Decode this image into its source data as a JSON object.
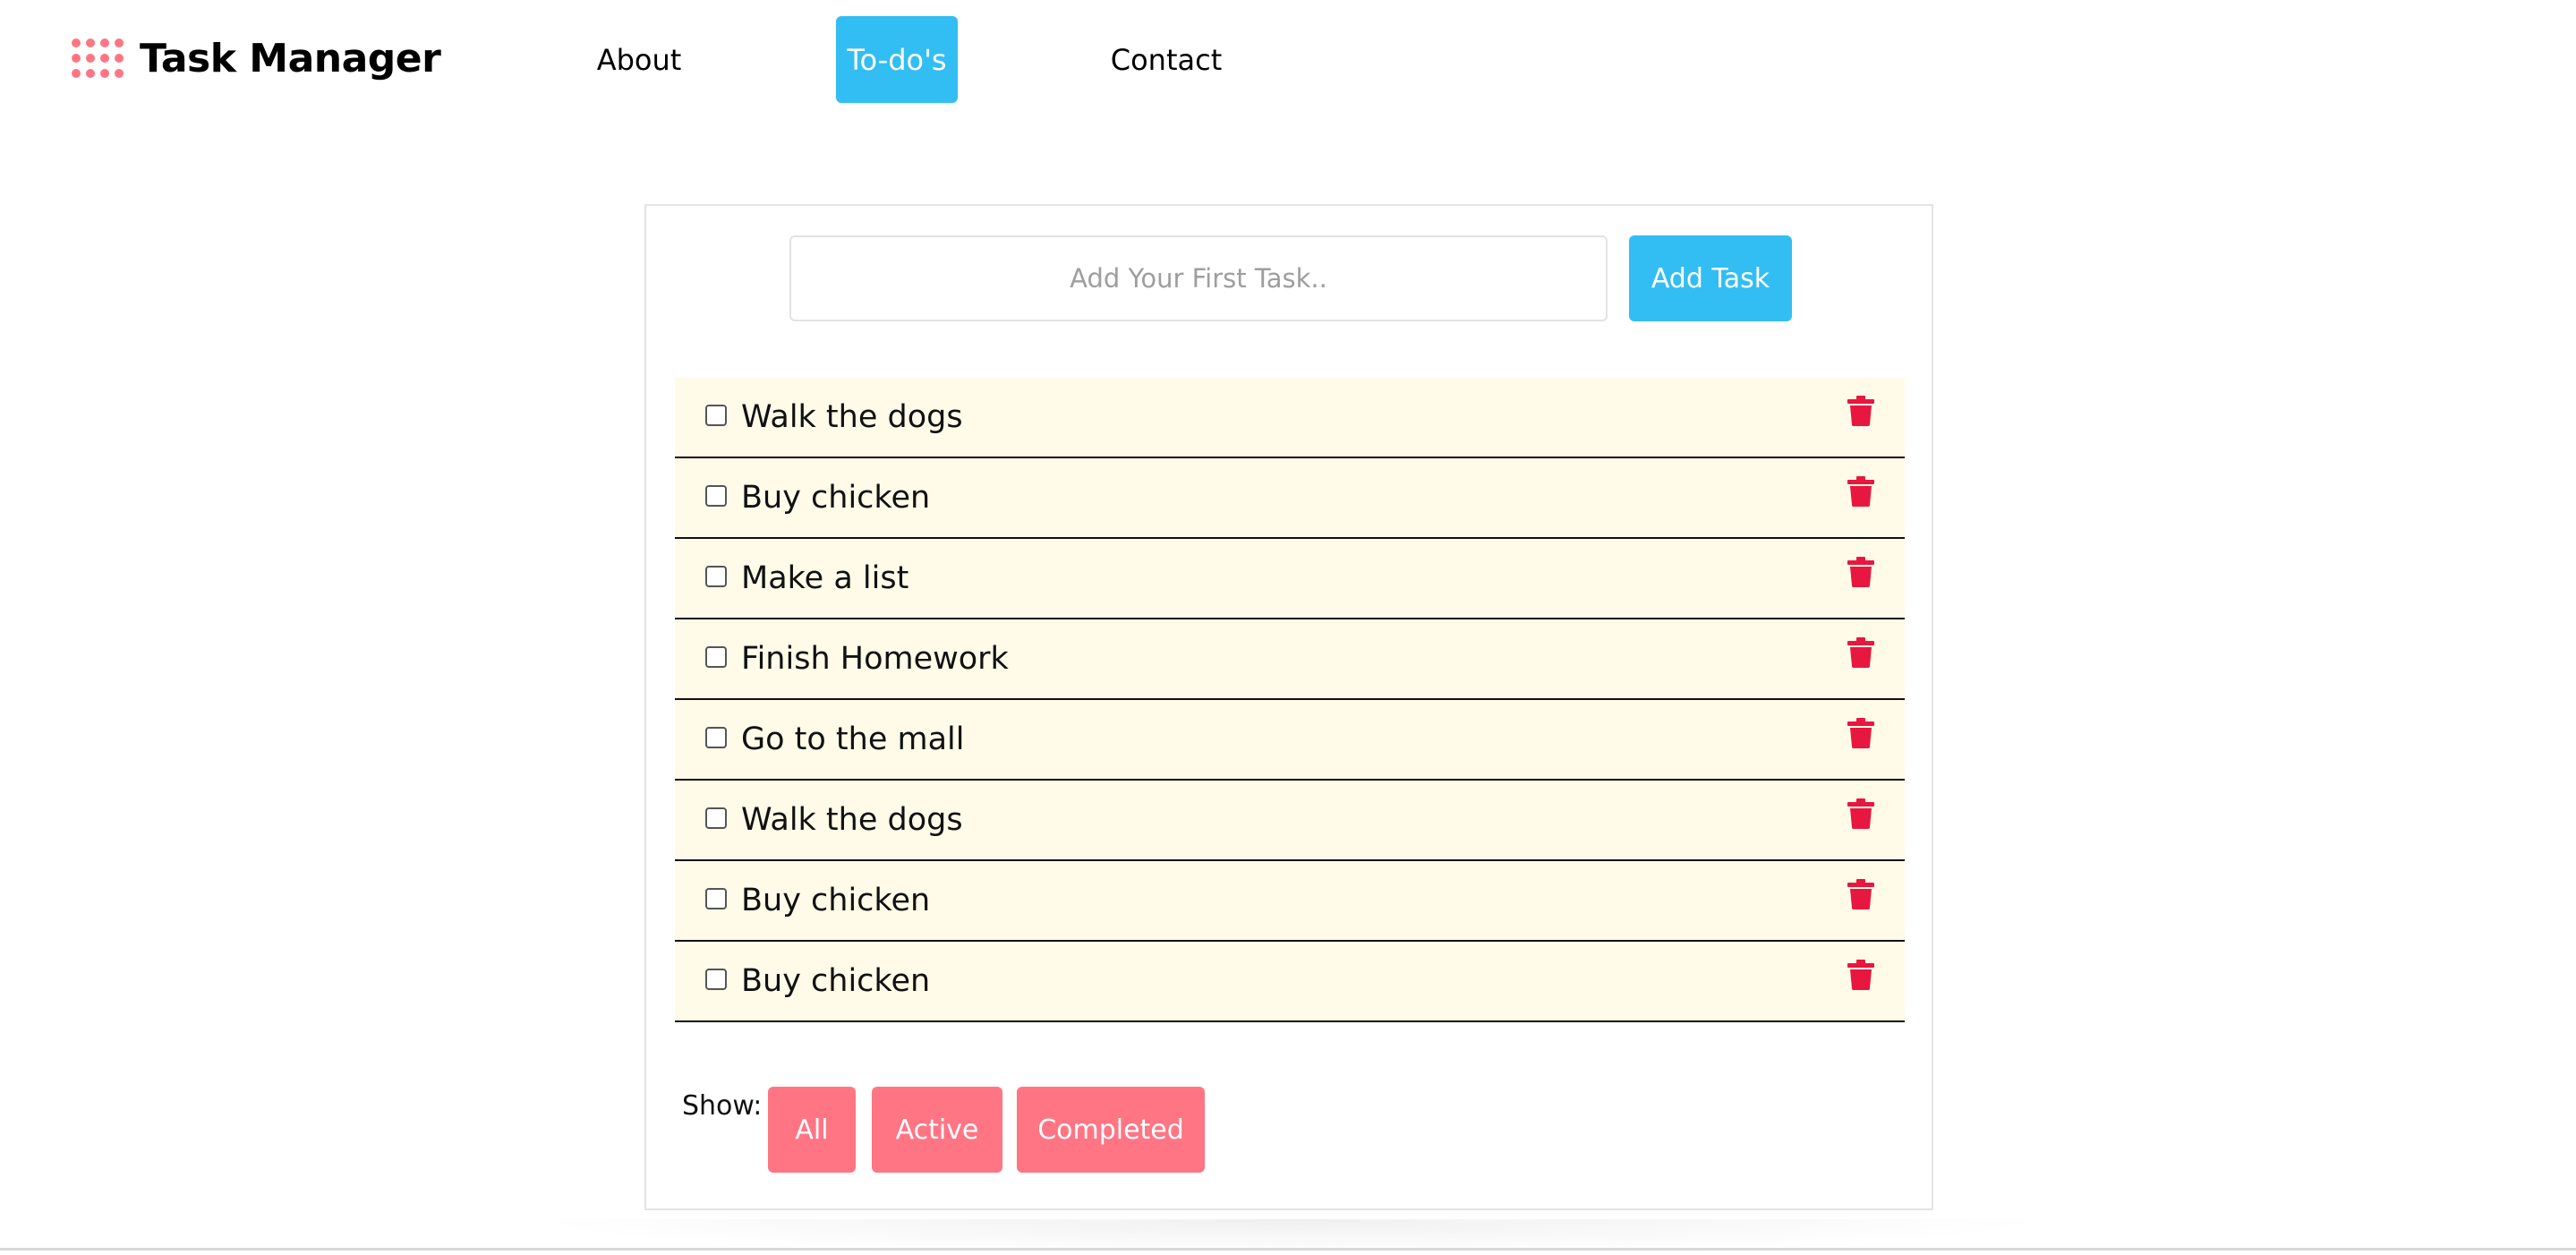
{
  "header": {
    "brand_title": "Task Manager",
    "brand_icon": "grid-dots-icon",
    "nav": [
      {
        "label": "About",
        "active": false
      },
      {
        "label": "To-do's",
        "active": true
      },
      {
        "label": "Contact",
        "active": false
      }
    ]
  },
  "todo": {
    "input_placeholder": "Add Your First Task..",
    "input_value": "",
    "add_label": "Add Task",
    "tasks": [
      {
        "label": "Walk the dogs",
        "checked": false
      },
      {
        "label": "Buy chicken",
        "checked": false
      },
      {
        "label": "Make a list",
        "checked": false
      },
      {
        "label": "Finish Homework",
        "checked": false
      },
      {
        "label": "Go to the mall",
        "checked": false
      },
      {
        "label": "Walk the dogs",
        "checked": false
      },
      {
        "label": "Buy chicken",
        "checked": false
      },
      {
        "label": "Buy chicken",
        "checked": false
      }
    ],
    "delete_icon": "trash-icon",
    "filter": {
      "show_label": "Show:",
      "options": [
        "All",
        "Active",
        "Completed"
      ]
    }
  },
  "colors": {
    "accent_blue": "#32bef2",
    "accent_pink": "#ff7584",
    "row_background": "#fffbe8",
    "trash_red": "#e8173f"
  }
}
